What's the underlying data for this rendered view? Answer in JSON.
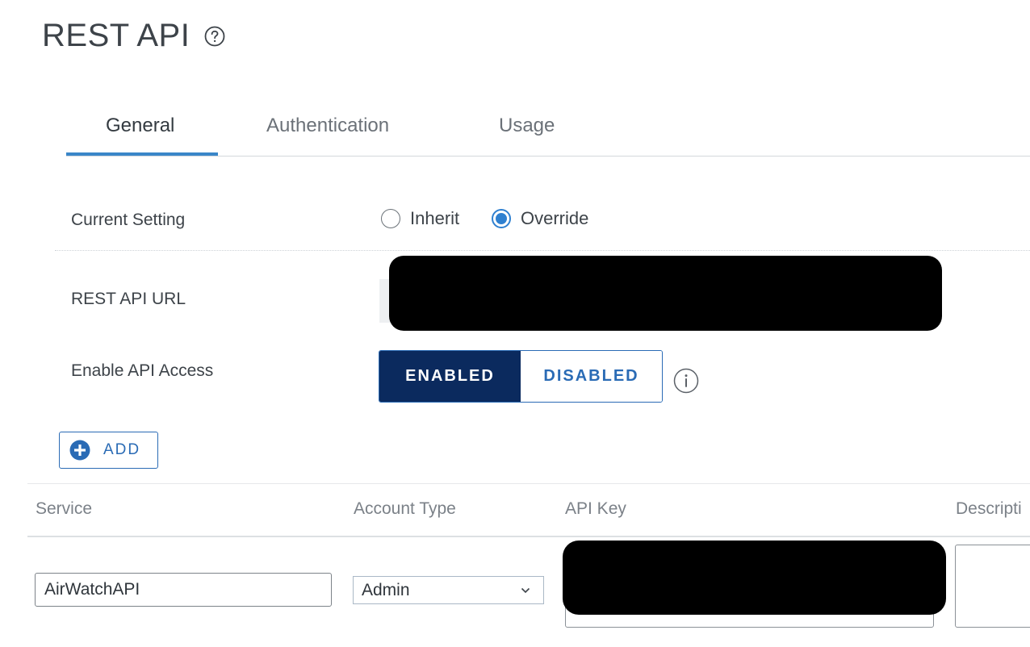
{
  "page": {
    "title": "REST API"
  },
  "tabs": [
    {
      "label": "General",
      "active": true
    },
    {
      "label": "Authentication",
      "active": false
    },
    {
      "label": "Usage",
      "active": false
    }
  ],
  "form": {
    "current_setting": {
      "label": "Current Setting",
      "options": [
        "Inherit",
        "Override"
      ],
      "selected": "Override"
    },
    "rest_api_url": {
      "label": "REST API URL"
    },
    "enable_api_access": {
      "label": "Enable API Access",
      "options": [
        "ENABLED",
        "DISABLED"
      ],
      "selected": "ENABLED"
    }
  },
  "add_button": {
    "label": "ADD"
  },
  "table": {
    "columns": [
      "Service",
      "Account Type",
      "API Key",
      "Descripti"
    ],
    "rows": [
      {
        "service": "AirWatchAPI",
        "account_type": "Admin"
      }
    ]
  },
  "colors": {
    "accent": "#2f80d0",
    "toggle_active_bg": "#0b2a5e",
    "toggle_border": "#2a6bb5",
    "tab_underline": "#3a86c8",
    "redaction": "#000000"
  },
  "icons": {
    "title_help": "help-circle-icon",
    "toggle_info": "info-icon",
    "add": "plus-circle-icon",
    "select": "chevron-down-icon"
  }
}
